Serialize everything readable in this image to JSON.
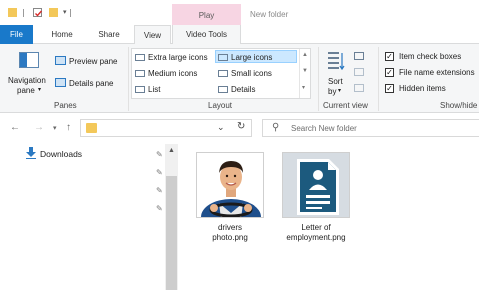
{
  "window": {
    "title": "New folder",
    "contextual_tab_group": "Play"
  },
  "tabs": {
    "file": "File",
    "home": "Home",
    "share": "Share",
    "view": "View",
    "video_tools": "Video Tools"
  },
  "ribbon": {
    "panes": {
      "navigation_pane_line1": "Navigation",
      "navigation_pane_line2": "pane",
      "preview_pane": "Preview pane",
      "details_pane": "Details pane",
      "group_label": "Panes"
    },
    "layout": {
      "extra_large_icons": "Extra large icons",
      "large_icons": "Large icons",
      "medium_icons": "Medium icons",
      "small_icons": "Small icons",
      "list": "List",
      "details": "Details",
      "selected": "Large icons",
      "group_label": "Layout"
    },
    "current_view": {
      "sort_by_line1": "Sort",
      "sort_by_line2": "by",
      "group_label": "Current view"
    },
    "show_hide": {
      "item_check_boxes": "Item check boxes",
      "file_name_extensions": "File name extensions",
      "hidden_items": "Hidden items",
      "item_check_boxes_checked": true,
      "file_name_extensions_checked": true,
      "hidden_items_checked": true,
      "group_label": "Show/hide"
    }
  },
  "address_bar": {
    "path": "",
    "search_placeholder": "Search New folder"
  },
  "nav_pane": {
    "items": [
      {
        "label": "Downloads",
        "pinned": true
      }
    ]
  },
  "files": [
    {
      "name_line1": "drivers",
      "name_line2": "photo.png",
      "icon": "person-photo-thumbnail"
    },
    {
      "name_line1": "Letter of",
      "name_line2": "employment.png",
      "icon": "document-thumbnail"
    }
  ],
  "colors": {
    "file_tab": "#1979ca",
    "play_tab": "#f7d5e3",
    "selection": "#cce8ff",
    "folder": "#f3c85a",
    "document_blue": "#1c5a7e"
  }
}
